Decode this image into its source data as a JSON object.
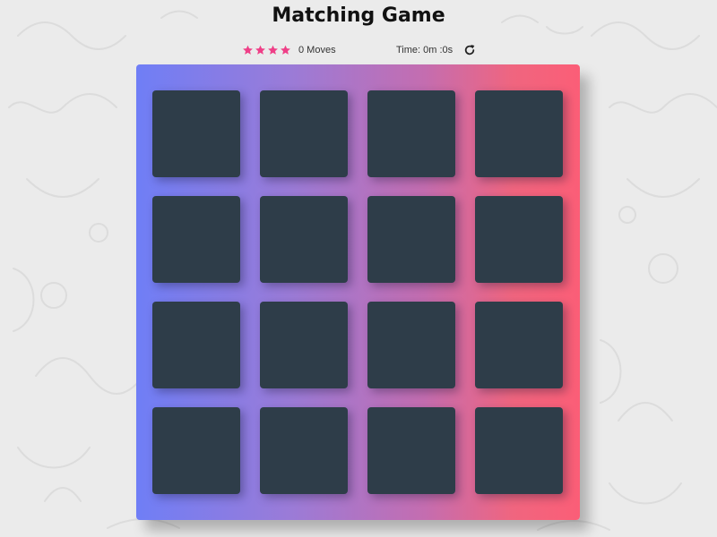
{
  "header": {
    "title": "Matching Game"
  },
  "score_panel": {
    "stars": [
      {
        "icon": "star-icon",
        "filled": true
      },
      {
        "icon": "star-icon",
        "filled": true
      },
      {
        "icon": "star-icon",
        "filled": true
      },
      {
        "icon": "star-icon",
        "filled": true
      }
    ],
    "moves_text": "0 Moves",
    "timer_text": "Time: 0m :0s",
    "restart_icon": "restart-icon"
  },
  "deck": {
    "rows": 4,
    "columns": 4,
    "cards": [
      {
        "state": "face-down"
      },
      {
        "state": "face-down"
      },
      {
        "state": "face-down"
      },
      {
        "state": "face-down"
      },
      {
        "state": "face-down"
      },
      {
        "state": "face-down"
      },
      {
        "state": "face-down"
      },
      {
        "state": "face-down"
      },
      {
        "state": "face-down"
      },
      {
        "state": "face-down"
      },
      {
        "state": "face-down"
      },
      {
        "state": "face-down"
      },
      {
        "state": "face-down"
      },
      {
        "state": "face-down"
      },
      {
        "state": "face-down"
      },
      {
        "state": "face-down"
      }
    ]
  },
  "colors": {
    "background": "#ebebeb",
    "star": "#ef3f87",
    "card_back": "#2e3d49",
    "deck_gradient_start": "#6f7ef6",
    "deck_gradient_end": "#fb5e77"
  }
}
